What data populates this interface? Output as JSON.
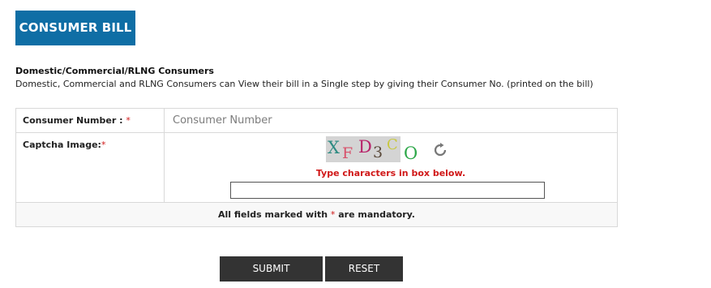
{
  "page": {
    "title": "CONSUMER BILL",
    "heading": "Domestic/Commercial/RLNG Consumers",
    "description": "Domestic, Commercial and RLNG Consumers can View their bill in a Single step by giving their Consumer No. (printed on the bill)"
  },
  "form": {
    "consumer_label": "Consumer Number : ",
    "consumer_placeholder": "Consumer Number",
    "captcha_label": "Captcha Image:",
    "required_mark": "*",
    "captcha_chars": [
      {
        "ch": "X",
        "color": "#2e8b82"
      },
      {
        "ch": "F",
        "color": "#d8506a"
      },
      {
        "ch": "D",
        "color": "#b8246a"
      },
      {
        "ch": "3",
        "color": "#5a4a3a"
      },
      {
        "ch": "C",
        "color": "#c8c840"
      },
      {
        "ch": "O",
        "color": "#2ea84a"
      }
    ],
    "captcha_hint": "Type characters in box below.",
    "captcha_input_value": "",
    "mandatory_prefix": "All fields marked with ",
    "mandatory_suffix": " are mandatory."
  },
  "buttons": {
    "submit": "SUBMIT",
    "reset": "RESET"
  },
  "colors": {
    "banner": "#0f6ea5",
    "required": "#d01818",
    "button": "#333333"
  },
  "icons": {
    "refresh": "refresh-icon"
  }
}
